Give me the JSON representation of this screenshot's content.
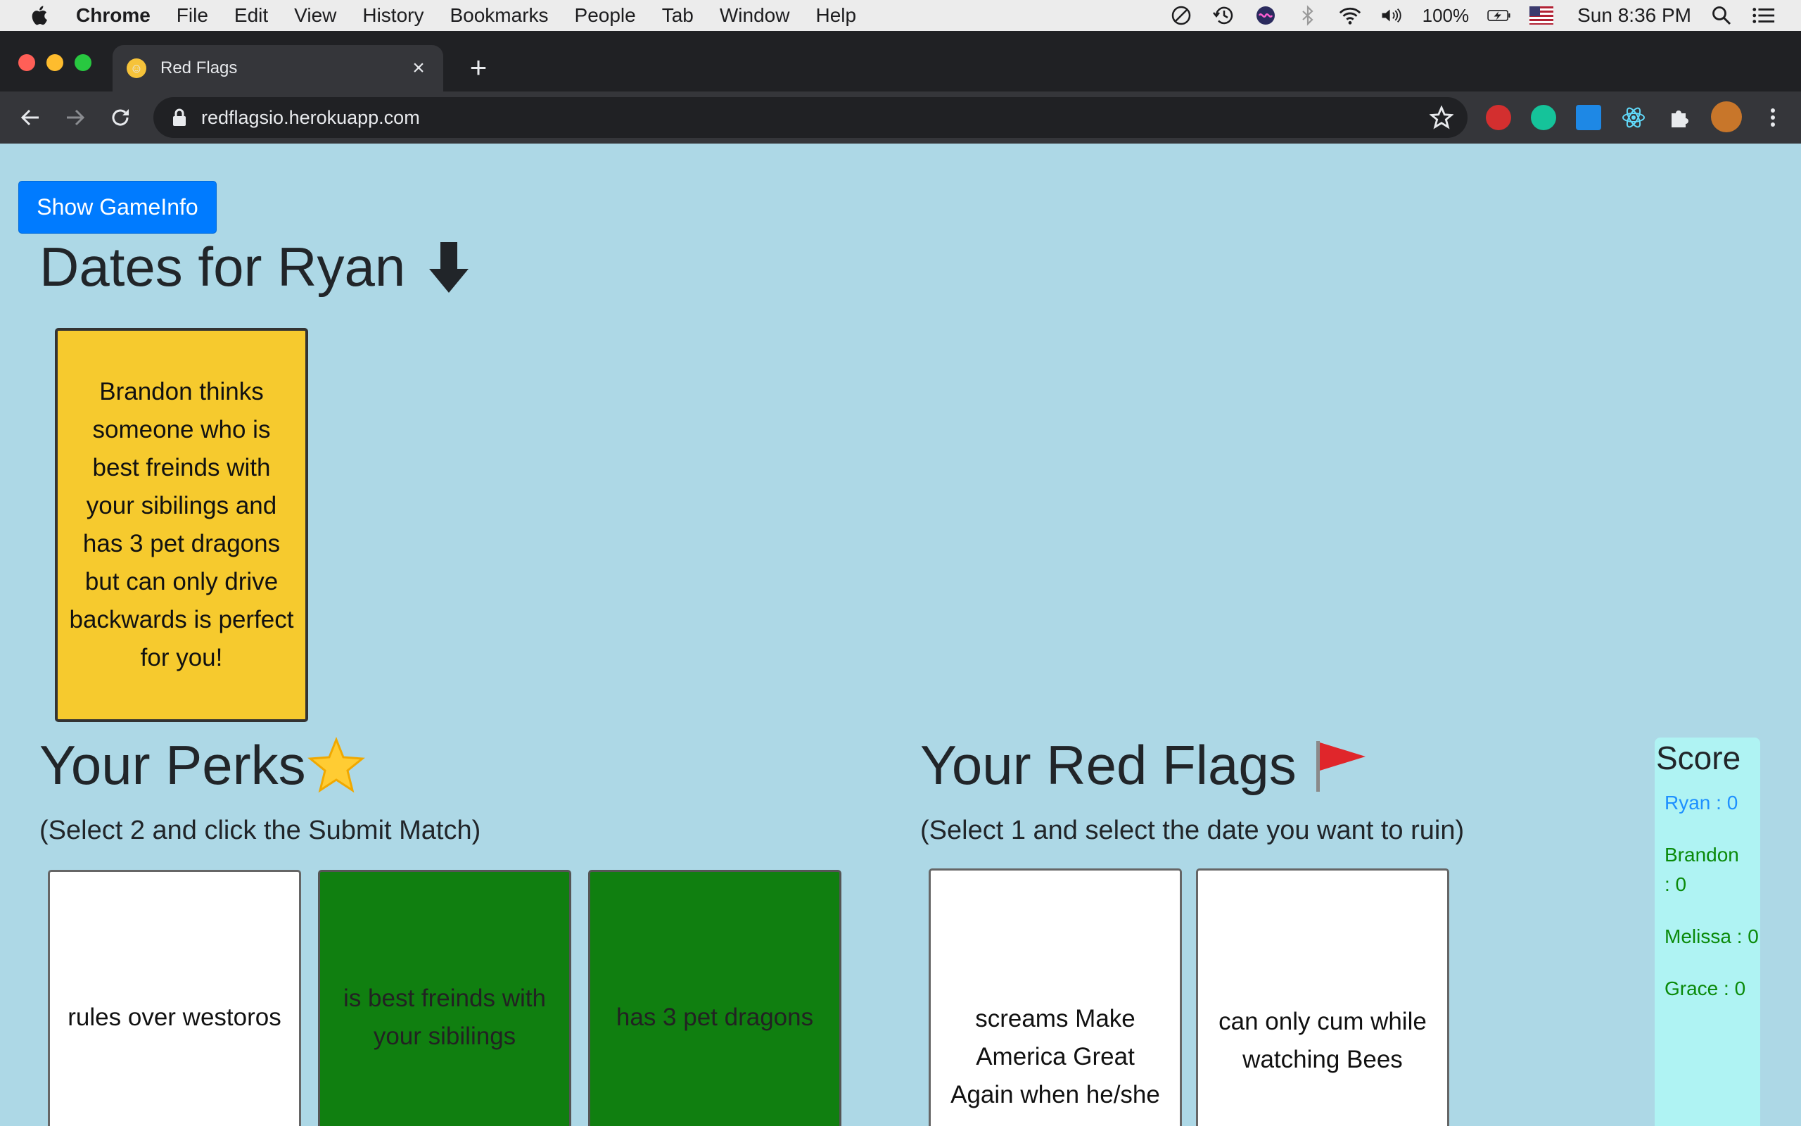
{
  "menubar": {
    "items": [
      "Chrome",
      "File",
      "Edit",
      "View",
      "History",
      "Bookmarks",
      "People",
      "Tab",
      "Window",
      "Help"
    ],
    "battery": "100%",
    "clock": "Sun 8:36 PM"
  },
  "browser": {
    "tab_title": "Red Flags",
    "url": "redflagsio.herokuapp.com"
  },
  "game": {
    "show_gameinfo_label": "Show GameInfo",
    "dates_title": "Dates for Ryan",
    "date_card": "Brandon thinks someone who is best freinds with your sibilings and has 3 pet dragons but can only drive backwards is perfect for you!",
    "perks": {
      "title": "Your Perks",
      "subtitle": "(Select 2 and click the Submit Match)",
      "cards": [
        {
          "text": "rules over westoros",
          "selected": false
        },
        {
          "text": "is best freinds with your sibilings",
          "selected": true
        },
        {
          "text": "has 3 pet dragons",
          "selected": true
        }
      ]
    },
    "red_flags": {
      "title": "Your Red Flags",
      "subtitle": "(Select 1 and select the date you want to ruin)",
      "cards": [
        {
          "text": "screams Make America Great Again when he/she cums"
        },
        {
          "text": "can only cum while watching Bees"
        }
      ]
    },
    "score": {
      "title": "Score",
      "players": [
        {
          "label": "Ryan : 0",
          "color": "#1e90ff"
        },
        {
          "label": "Brandon : 0",
          "color": "#0a8a0a"
        },
        {
          "label": "Melissa : 0",
          "color": "#0a8a0a"
        },
        {
          "label": "Grace : 0",
          "color": "#0a8a0a"
        }
      ]
    }
  },
  "colors": {
    "page_bg": "#add8e6",
    "button_blue": "#007bff",
    "date_card_yellow": "#f6ca2e",
    "perk_selected_green": "#107f10",
    "score_bg": "#aff3f3"
  }
}
